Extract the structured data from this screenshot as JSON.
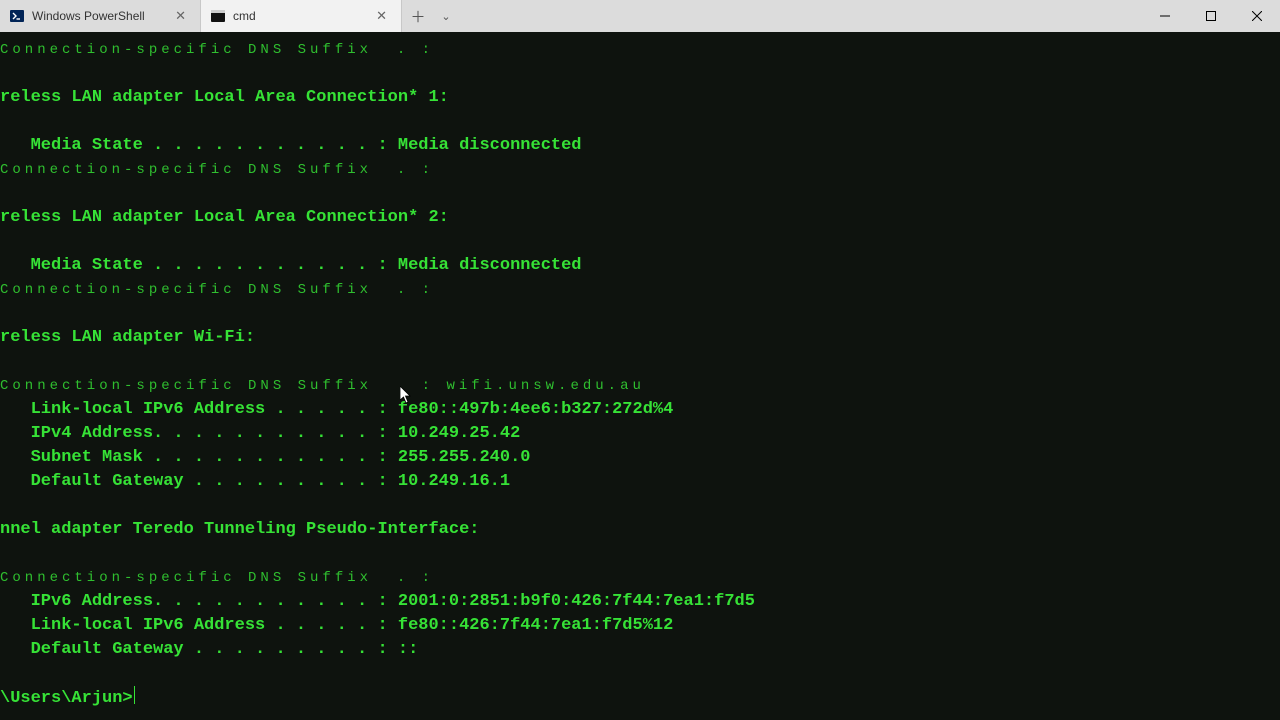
{
  "tabs": {
    "powershell": "Windows PowerShell",
    "cmd": "cmd"
  },
  "out": {
    "dns_suffix_line": "Connection-specific DNS Suffix  . :",
    "adapter_lac1": "reless LAN adapter Local Area Connection* 1:",
    "media_state_disc": "   Media State . . . . . . . . . . . : Media disconnected",
    "adapter_lac2": "reless LAN adapter Local Area Connection* 2:",
    "adapter_wifi": "reless LAN adapter Wi-Fi:",
    "dns_suffix_wifi": "Connection-specific DNS Suffix  . : wifi.unsw.edu.au",
    "link_local_v6_1": "   Link-local IPv6 Address . . . . . : fe80::497b:4ee6:b327:272d%4",
    "ipv4": "   IPv4 Address. . . . . . . . . . . : 10.249.25.42",
    "subnet": "   Subnet Mask . . . . . . . . . . . : 255.255.240.0",
    "gw": "   Default Gateway . . . . . . . . . : 10.249.16.1",
    "adapter_teredo": "nnel adapter Teredo Tunneling Pseudo-Interface:",
    "ipv6": "   IPv6 Address. . . . . . . . . . . : 2001:0:2851:b9f0:426:7f44:7ea1:f7d5",
    "link_local_v6_2": "   Link-local IPv6 Address . . . . . : fe80::426:7f44:7ea1:f7d5%12",
    "gw2": "   Default Gateway . . . . . . . . . : ::",
    "prompt": "\\Users\\Arjun>"
  }
}
